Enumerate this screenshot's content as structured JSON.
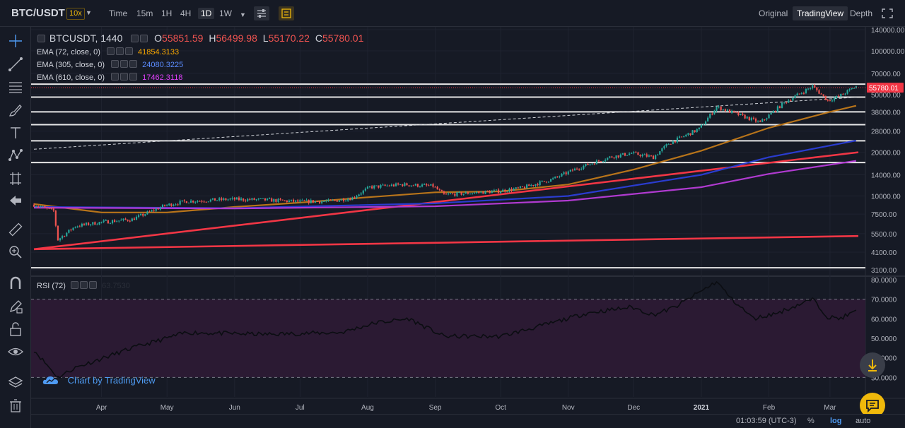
{
  "header": {
    "symbol": "BTC/USDT",
    "leverage": "10x",
    "timeframes": [
      "Time",
      "15m",
      "1H",
      "4H",
      "1D",
      "1W"
    ],
    "active_timeframe": "1D",
    "views": [
      "Original",
      "TradingView",
      "Depth"
    ],
    "active_view": "TradingView"
  },
  "legend": {
    "symbol_label": "BTCUSDT, 1440",
    "open_key": "O",
    "open": "55851.59",
    "high_key": "H",
    "high": "56499.98",
    "low_key": "L",
    "low": "55170.22",
    "close_key": "C",
    "close": "55780.01",
    "ema": [
      {
        "label": "EMA (72, close, 0)",
        "value": "41854.3133",
        "color": "#f7a600"
      },
      {
        "label": "EMA (305, close, 0)",
        "value": "24080.3225",
        "color": "#2962ff"
      },
      {
        "label": "EMA (610, close, 0)",
        "value": "17462.3118",
        "color": "#e040fb"
      }
    ],
    "rsi_label": "RSI (72)",
    "rsi_value": "63.7530"
  },
  "credit": "Chart by TradingView",
  "status": {
    "time": "01:03:59 (UTC-3)",
    "percent": "%",
    "log": "log",
    "auto": "auto"
  },
  "colors": {
    "up": "#26a69a",
    "down": "#ef5350",
    "bg": "#161a25",
    "grid": "#1f2330",
    "rsi_band": "#2b1a33",
    "ema72": "#b8741a",
    "ema305": "#2a3ccf",
    "ema610": "#b03ad0",
    "trend": "#f23645",
    "price_tag": "#f23645"
  },
  "chart_data": {
    "type": "candlestick",
    "scale": "log",
    "price_axis_labels": [
      "140000.00",
      "100000.00",
      "70000.00",
      "50000.00",
      "38000.00",
      "28000.00",
      "20000.00",
      "14000.00",
      "10000.00",
      "7500.00",
      "5500.00",
      "4100.00",
      "3100.00"
    ],
    "price_axis_values": [
      140000,
      100000,
      70000,
      50000,
      38000,
      28000,
      20000,
      14000,
      10000,
      7500,
      5500,
      4100,
      3100
    ],
    "last_price": "55780.01",
    "x_labels": [
      "Apr",
      "May",
      "Jun",
      "Jul",
      "Aug",
      "Sep",
      "Oct",
      "Nov",
      "Dec",
      "2021",
      "Feb",
      "Mar"
    ],
    "x_start": "2020-03-01",
    "x_end": "2021-03-14",
    "x_label_dates": [
      "2020-04-01",
      "2020-05-01",
      "2020-06-01",
      "2020-07-01",
      "2020-08-01",
      "2020-09-01",
      "2020-10-01",
      "2020-11-01",
      "2020-12-01",
      "2021-01-01",
      "2021-02-01",
      "2021-03-01"
    ],
    "price_path": [
      [
        "2020-03-01",
        8700
      ],
      [
        "2020-03-10",
        7900
      ],
      [
        "2020-03-12",
        5000
      ],
      [
        "2020-03-20",
        6200
      ],
      [
        "2020-04-01",
        6600
      ],
      [
        "2020-04-15",
        6900
      ],
      [
        "2020-04-30",
        8600
      ],
      [
        "2020-05-10",
        9200
      ],
      [
        "2020-05-31",
        9500
      ],
      [
        "2020-06-15",
        9400
      ],
      [
        "2020-06-30",
        9150
      ],
      [
        "2020-07-15",
        9200
      ],
      [
        "2020-07-25",
        9700
      ],
      [
        "2020-08-02",
        11500
      ],
      [
        "2020-08-17",
        12000
      ],
      [
        "2020-08-31",
        11700
      ],
      [
        "2020-09-05",
        10200
      ],
      [
        "2020-09-30",
        10800
      ],
      [
        "2020-10-10",
        11300
      ],
      [
        "2020-10-25",
        13100
      ],
      [
        "2020-11-05",
        15500
      ],
      [
        "2020-11-20",
        18500
      ],
      [
        "2020-11-30",
        19700
      ],
      [
        "2020-12-10",
        18500
      ],
      [
        "2020-12-17",
        23000
      ],
      [
        "2020-12-31",
        29000
      ],
      [
        "2021-01-08",
        41000
      ],
      [
        "2021-01-20",
        35500
      ],
      [
        "2021-01-28",
        32000
      ],
      [
        "2021-02-08",
        44000
      ],
      [
        "2021-02-21",
        57000
      ],
      [
        "2021-02-28",
        45500
      ],
      [
        "2021-03-05",
        48500
      ],
      [
        "2021-03-13",
        57000
      ]
    ],
    "ema": [
      {
        "name": "EMA (72, close, 0)",
        "points": [
          [
            "2020-03-01",
            8800
          ],
          [
            "2020-04-01",
            7700
          ],
          [
            "2020-05-01",
            7700
          ],
          [
            "2020-06-01",
            8400
          ],
          [
            "2020-07-01",
            9000
          ],
          [
            "2020-08-01",
            9800
          ],
          [
            "2020-09-01",
            10600
          ],
          [
            "2020-10-01",
            10750
          ],
          [
            "2020-11-01",
            12000
          ],
          [
            "2020-12-01",
            15200
          ],
          [
            "2021-01-01",
            20500
          ],
          [
            "2021-02-01",
            29500
          ],
          [
            "2021-03-01",
            38000
          ],
          [
            "2021-03-13",
            41854
          ]
        ]
      },
      {
        "name": "EMA (305, close, 0)",
        "points": [
          [
            "2020-03-01",
            8400
          ],
          [
            "2020-06-01",
            8250
          ],
          [
            "2020-09-01",
            8900
          ],
          [
            "2020-11-01",
            10000
          ],
          [
            "2021-01-01",
            14000
          ],
          [
            "2021-02-01",
            18500
          ],
          [
            "2021-03-13",
            24080
          ]
        ]
      },
      {
        "name": "EMA (610, close, 0)",
        "points": [
          [
            "2020-03-01",
            8300
          ],
          [
            "2020-06-01",
            8200
          ],
          [
            "2020-09-01",
            8500
          ],
          [
            "2020-11-01",
            9300
          ],
          [
            "2021-01-01",
            11500
          ],
          [
            "2021-02-01",
            14200
          ],
          [
            "2021-03-13",
            17462
          ]
        ]
      }
    ],
    "horizontal_levels": [
      59000,
      48000,
      38000,
      31000,
      24000,
      17000,
      3200
    ],
    "trendlines": [
      {
        "from": [
          "2020-03-01",
          4300
        ],
        "to": [
          "2021-03-14",
          5300
        ],
        "style": "solid"
      },
      {
        "from": [
          "2020-03-01",
          4300
        ],
        "to": [
          "2021-03-14",
          20000
        ],
        "style": "solid"
      },
      {
        "from": [
          "2020-03-01",
          21000
        ],
        "to": [
          "2021-03-14",
          48000
        ],
        "style": "dashed"
      }
    ],
    "rsi": {
      "name": "RSI (72)",
      "axis_labels": [
        "80.0000",
        "70.0000",
        "60.0000",
        "50.0000",
        "40.0000",
        "30.0000"
      ],
      "axis_values": [
        80,
        70,
        60,
        50,
        40,
        30
      ],
      "band": [
        30,
        70
      ],
      "points": [
        [
          "2020-03-01",
          44
        ],
        [
          "2020-03-12",
          30
        ],
        [
          "2020-03-20",
          35
        ],
        [
          "2020-04-15",
          45
        ],
        [
          "2020-05-10",
          53
        ],
        [
          "2020-06-15",
          52
        ],
        [
          "2020-07-20",
          53
        ],
        [
          "2020-08-05",
          58
        ],
        [
          "2020-08-20",
          60
        ],
        [
          "2020-09-05",
          51
        ],
        [
          "2020-10-01",
          51
        ],
        [
          "2020-10-25",
          58
        ],
        [
          "2020-11-10",
          63
        ],
        [
          "2020-11-30",
          66
        ],
        [
          "2020-12-10",
          62
        ],
        [
          "2020-12-20",
          66
        ],
        [
          "2021-01-08",
          79
        ],
        [
          "2021-01-15",
          70
        ],
        [
          "2021-01-25",
          60
        ],
        [
          "2021-02-05",
          63
        ],
        [
          "2021-02-21",
          70
        ],
        [
          "2021-02-28",
          61
        ],
        [
          "2021-03-05",
          60
        ],
        [
          "2021-03-13",
          63.75
        ]
      ]
    }
  }
}
